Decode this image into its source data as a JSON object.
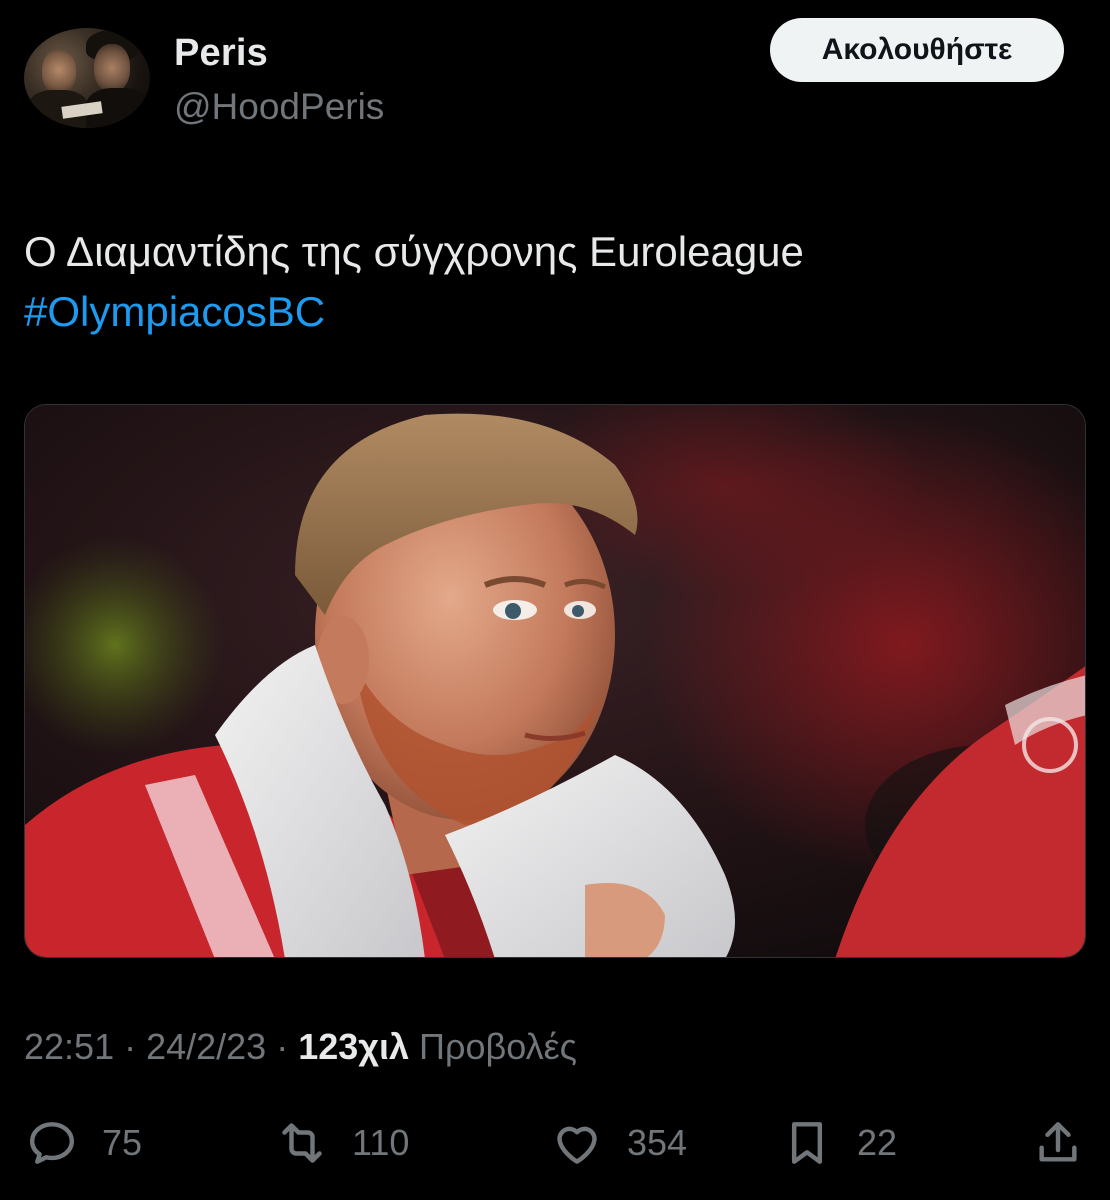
{
  "author": {
    "display_name": "Peris",
    "handle": "@HoodPeris",
    "follow_label": "Ακολουθήστε"
  },
  "tweet": {
    "text": "Ο Διαμαντίδης της σύγχρονης Euroleague",
    "hashtag": "#OlympiacosBC"
  },
  "meta": {
    "time": "22:51",
    "separator": " · ",
    "date": "24/2/23",
    "views_count": "123χιλ",
    "views_label": "Προβολές"
  },
  "actions": {
    "replies": "75",
    "retweets": "110",
    "likes": "354",
    "bookmarks": "22",
    "icons": [
      "reply-icon",
      "retweet-icon",
      "like-icon",
      "bookmark-icon",
      "share-icon"
    ]
  },
  "colors": {
    "background": "#000000",
    "text": "#e7e9ea",
    "secondary": "#71767b",
    "link": "#1d9bf0",
    "button_bg": "#eff3f4"
  }
}
